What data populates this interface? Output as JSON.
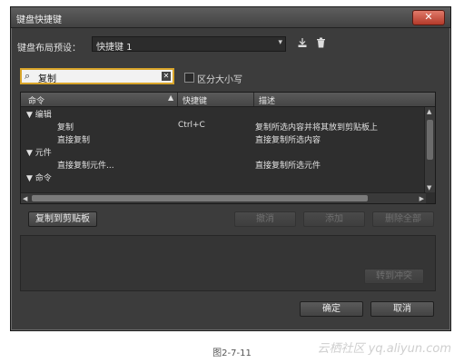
{
  "window": {
    "title": "键盘快捷键",
    "close_glyph": "✕"
  },
  "preset": {
    "label": "键盘布局预设：",
    "value": "快捷键 1"
  },
  "search": {
    "value": "复制",
    "case_label": "区分大小写"
  },
  "table": {
    "headers": [
      "命令",
      "快捷键",
      "描述"
    ],
    "rows": [
      {
        "toggle": "▼",
        "cmd": "编辑",
        "shortcut": "",
        "desc": "",
        "level": 0
      },
      {
        "toggle": "",
        "cmd": "复制",
        "shortcut": "Ctrl+C",
        "desc": "复制所选内容并将其放到剪贴板上",
        "level": 1
      },
      {
        "toggle": "",
        "cmd": "直接复制",
        "shortcut": "",
        "desc": "直接复制所选内容",
        "level": 1
      },
      {
        "toggle": "▼",
        "cmd": "元件",
        "shortcut": "",
        "desc": "",
        "level": 0
      },
      {
        "toggle": "",
        "cmd": "直接复制元件...",
        "shortcut": "",
        "desc": "直接复制所选元件",
        "level": 1
      },
      {
        "toggle": "▼",
        "cmd": "命令",
        "shortcut": "",
        "desc": "",
        "level": 0
      }
    ]
  },
  "buttons": {
    "copy_to_clipboard": "复制到剪贴板",
    "undo": "撤消",
    "add": "添加",
    "delete_all": "删除全部",
    "go_to_conflict": "转到冲突",
    "ok": "确定",
    "cancel": "取消"
  },
  "caption": "图2-7-11",
  "watermark": "云栖社区 yq.aliyun.com"
}
